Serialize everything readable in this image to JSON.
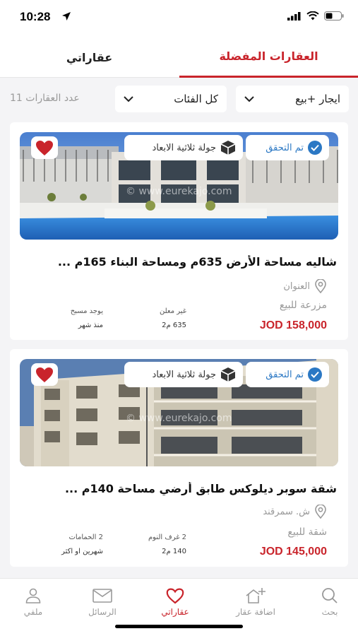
{
  "status": {
    "time": "10:28"
  },
  "tabs": {
    "favorites": "العقارات المفضلة",
    "my_properties": "عقاراتي"
  },
  "filters": {
    "type": "ايجار +بيع",
    "category": "كل الفئات",
    "count": "عدد العقارات 11"
  },
  "listings": [
    {
      "verified": "تم التحقق",
      "tour": "جولة ثلاثية الابعاد",
      "watermark": "© www.eurekajo.com",
      "title": "شاليه مساحة الأرض 635م ومساحة البناء 165م ...",
      "address": "العنوان",
      "category": "مزرعة للبيع",
      "price": "JOD 158,000",
      "spec1_key": "غير معلن",
      "spec1_val": "635 م2",
      "spec2_key": "يوجد مسبح",
      "spec2_val": "منذ شهر"
    },
    {
      "verified": "تم التحقق",
      "tour": "جولة ثلاثية الابعاد",
      "watermark": "© www.eurekajo.com",
      "title": "شقة سوبر ديلوكس طابق أرضي مساحة 140م ...",
      "address": "ش. سمرقند",
      "category": "شقة للبيع",
      "price": "JOD 145,000",
      "spec1_key": "2 غرف النوم",
      "spec1_val": "140 م2",
      "spec2_key": "2 الحمامات",
      "spec2_val": "شهرين او اكثر"
    }
  ],
  "nav": {
    "search": "بحث",
    "add": "اضافة عقار",
    "mine": "عقاراتي",
    "messages": "الرسائل",
    "profile": "ملفي"
  },
  "colors": {
    "accent": "#c9242b",
    "verified": "#2b78c4"
  }
}
